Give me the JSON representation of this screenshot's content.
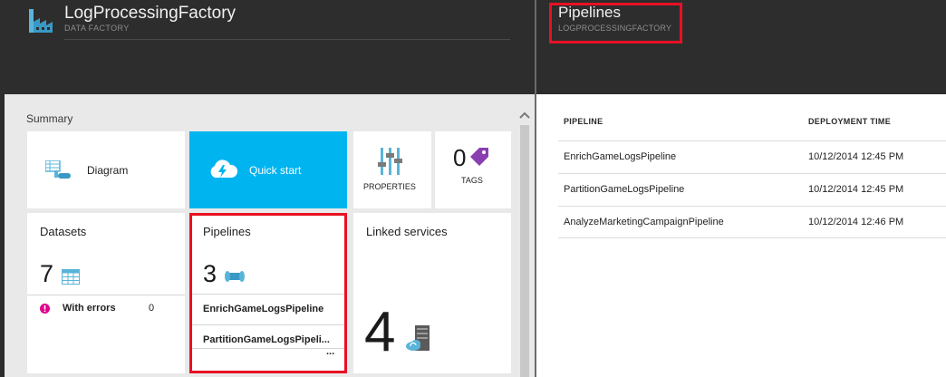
{
  "left_blade": {
    "title": "LogProcessingFactory",
    "subtitle": "DATA FACTORY",
    "summary_label": "Summary",
    "tiles": {
      "diagram": {
        "label": "Diagram"
      },
      "quick_start": {
        "label": "Quick start"
      },
      "properties": {
        "label": "PROPERTIES"
      },
      "tags": {
        "label": "TAGS",
        "count": "0"
      },
      "datasets": {
        "label": "Datasets",
        "count": "7",
        "errors_label": "With errors",
        "errors_count": "0"
      },
      "pipelines": {
        "label": "Pipelines",
        "count": "3",
        "items": [
          "EnrichGameLogsPipeline",
          "PartitionGameLogsPipeli..."
        ],
        "more": "..."
      },
      "linked_services": {
        "label": "Linked services",
        "count": "4"
      }
    }
  },
  "right_blade": {
    "title": "Pipelines",
    "subtitle": "LOGPROCESSINGFACTORY",
    "columns": [
      "PIPELINE",
      "DEPLOYMENT TIME"
    ],
    "rows": [
      {
        "pipeline": "EnrichGameLogsPipeline",
        "time": "10/12/2014 12:45 PM"
      },
      {
        "pipeline": "PartitionGameLogsPipeline",
        "time": "10/12/2014 12:45 PM"
      },
      {
        "pipeline": "AnalyzeMarketingCampaignPipeline",
        "time": "10/12/2014 12:46 PM"
      }
    ]
  },
  "colors": {
    "highlight_red": "#e81123",
    "quick_start_blue": "#00b4f0",
    "header_dark": "#2d2d2d",
    "tag_purple": "#8a3fb0",
    "error_pink": "#e3008c"
  }
}
